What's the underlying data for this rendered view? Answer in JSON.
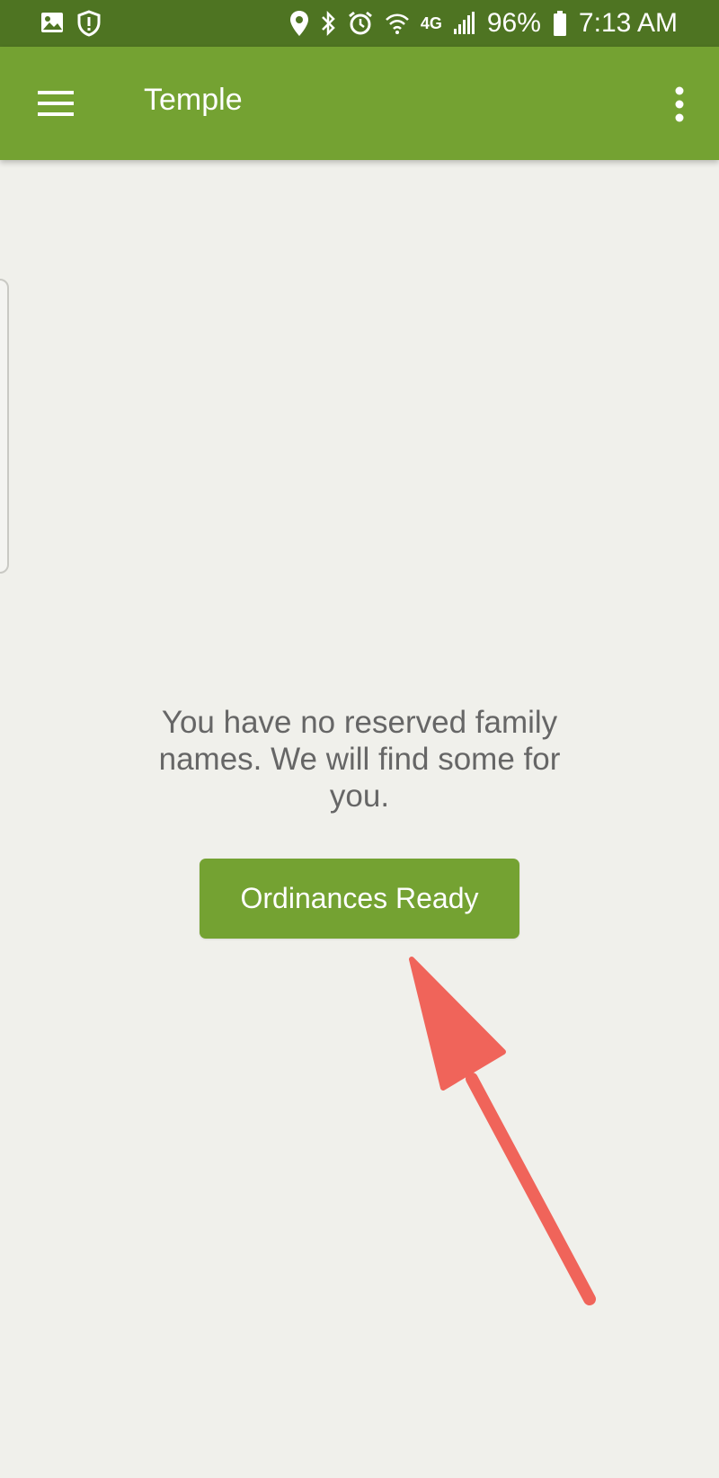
{
  "status_bar": {
    "battery_percent": "96%",
    "time": "7:13 AM",
    "network_label": "4G",
    "left_icons": [
      "image-icon",
      "shield-alert-icon"
    ],
    "right_icons": [
      "location-pin-icon",
      "bluetooth-icon",
      "alarm-icon",
      "wifi-icon",
      "network-4g-icon",
      "signal-icon",
      "battery-icon"
    ]
  },
  "app_bar": {
    "title": "Temple",
    "menu_icon": "hamburger-menu-icon",
    "overflow_icon": "more-vertical-icon"
  },
  "main": {
    "empty_message": "You have no reserved family names. We will find some for you.",
    "ordinances_button_label": "Ordinances Ready"
  },
  "colors": {
    "status_bar_bg": "#4e7422",
    "app_bar_bg": "#74a232",
    "button_bg": "#74a232",
    "page_bg": "#f0f0eb",
    "message_text": "#666666",
    "annotation_arrow": "#f0645a"
  }
}
